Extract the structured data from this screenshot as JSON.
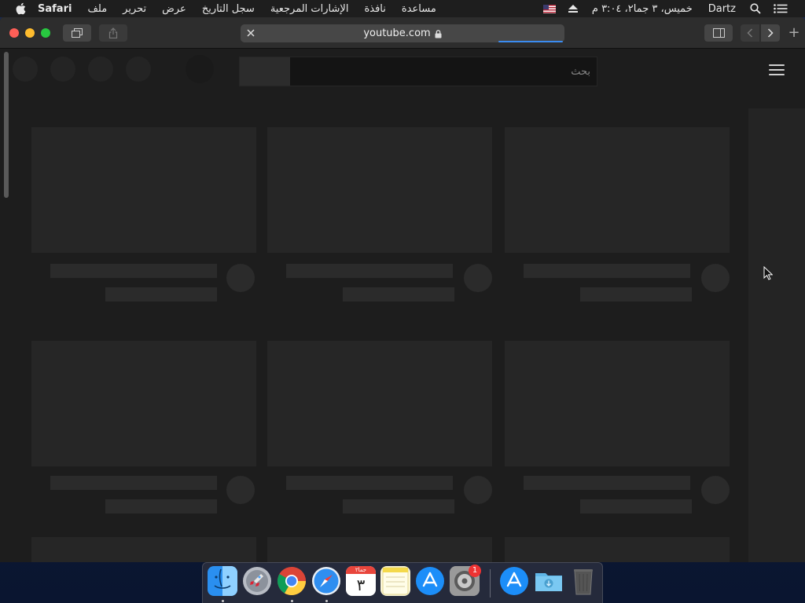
{
  "menubar": {
    "app_name": "Safari",
    "menus": [
      "ملف",
      "تحرير",
      "عرض",
      "سجل التاريخ",
      "الإشارات المرجعية",
      "نافذة",
      "مساعدة"
    ],
    "datetime": "خميس، ٣ جما٢، ٣:٠٤ م",
    "user": "Dartz"
  },
  "safari": {
    "url": "youtube.com",
    "new_tab": "+"
  },
  "youtube": {
    "search_placeholder": "بحث"
  },
  "dock": {
    "apps": [
      "Finder",
      "Launchpad",
      "Google Chrome",
      "Safari",
      "Calendar",
      "Notes",
      "App Store",
      "System Preferences",
      "App Store (Downloads)",
      "Downloads Folder",
      "Trash"
    ],
    "calendar_day": "٣",
    "calendar_month": "جما٢",
    "system_prefs_badge": "1"
  },
  "colors": {
    "menubar_bg": "#1e1e1e",
    "toolbar_bg": "#2d2d2d",
    "page_bg": "#1d1d1d",
    "progress_accent": "#3b8cf0",
    "traffic_red": "#fe5f57",
    "traffic_yellow": "#febc2e",
    "traffic_green": "#28c840"
  }
}
